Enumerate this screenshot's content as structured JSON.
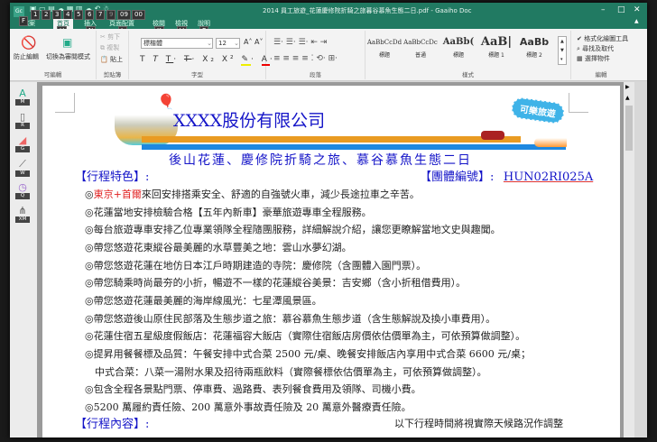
{
  "window": {
    "title": "2014 員工旅遊_花蓮慶修院折騎之旅暮谷慕魚生態二日.pdf - Gaaiho Doc",
    "app_icon": "Gc"
  },
  "quick_access_keys": [
    "1",
    "2",
    "3",
    "4",
    "5",
    "6",
    "7",
    "9",
    "09",
    "00"
  ],
  "tabs": [
    {
      "label": "檔案",
      "key": "F"
    },
    {
      "label": "首頁",
      "key": "H"
    },
    {
      "label": "插入",
      "key": "N"
    },
    {
      "label": "頁面配置",
      "key": "L"
    },
    {
      "label": "檢閱",
      "key": "K"
    },
    {
      "label": "檢視",
      "key": "V"
    },
    {
      "label": "說明",
      "key": "P"
    }
  ],
  "ribbon": {
    "protect": {
      "btn1": "防止編輯",
      "btn2": "切換為審閱模式",
      "label": "可編輯"
    },
    "clipboard": {
      "cut": "剪下",
      "copy": "複製",
      "paste": "貼上",
      "label": "剪貼簿"
    },
    "font": {
      "name": "標楷體",
      "size": "12",
      "label": "字型"
    },
    "paragraph": {
      "label": "段落"
    },
    "styles": {
      "items": [
        {
          "sample": "AaBbCcDd",
          "name": "標題"
        },
        {
          "sample": "AaBbCcDc",
          "name": "普通"
        },
        {
          "sample": "AaBb(",
          "name": "標題"
        },
        {
          "sample": "AaB|",
          "name": "標題 1"
        },
        {
          "sample": "AaBb",
          "name": "標題 2"
        }
      ],
      "label": "樣式"
    },
    "editing": {
      "format_painter": "格式化繪圖工具",
      "find_replace": "尋找及取代",
      "select_objects": "選擇物件",
      "label": "編輯"
    }
  },
  "left_tools": [
    {
      "key": "M",
      "icon": "text-icon"
    },
    {
      "key": "R",
      "icon": "document-search-icon"
    },
    {
      "key": "G",
      "icon": "shape-icon"
    },
    {
      "key": "W",
      "icon": "wand-icon"
    },
    {
      "key": "Q",
      "icon": "clock-icon"
    },
    {
      "key": "XM",
      "icon": "org-chart-icon"
    }
  ],
  "doc": {
    "company": "XXXX股份有限公司",
    "badge": "可樂旅遊",
    "subtitle": "後山花蓮、慶修院折騎之旅、慕谷慕魚生態二日",
    "features_heading": "【行程特色】:",
    "group_no_label": "【團體編號】:",
    "group_no": "HUN02RI025A",
    "line1_red": "東京+首爾",
    "line1_rest": "來回安排搭乘安全、舒適的自強號火車，減少長途拉車之辛苦。",
    "lines": [
      "◎花蓮當地安排檢驗合格【五年內新車】豪華旅遊專車全程服務。",
      "◎每台旅遊專車安排乙位專業領隊全程隨團服務，詳細解說介紹，讓您更瞭解當地文史與趣聞。",
      "◎帶您悠遊花東縱谷最美麗的水草豐美之地：雲山水夢幻湖。",
      "◎帶您悠遊花蓮在地仿日本江戶時期建造的寺院：慶修院（含團體入園門票）。",
      "◎帶您騎乘時尚最夯的小折，暢遊不一樣的花蓮縱谷美景：吉安鄉（含小折租借費用）。",
      "◎帶您悠遊花蓮最美麗的海岸線風光：七星潭風景區。",
      "◎帶您悠遊後山原住民部落及生態步道之旅：慕谷慕魚生態步道（含生態解說及換小車費用）。",
      "◎花蓮住宿五星級度假飯店：花蓮福容大飯店（實際住宿飯店房價依估價單為主，可依預算做調整）。",
      "◎提昇用餐餐標及品質：午餐安排中式合菜 2500 元/桌、晚餐安排飯店內享用中式合菜 6600 元/桌；",
      "　中式合菜：八菜一湯附水果及招待兩瓶飲料（實際餐標依估價單為主，可依預算做調整）。",
      "◎包含全程各景點門票、停車費、過路費、表列餐食費用及領隊、司機小費。",
      "◎5200 萬履約責任險、200 萬意外事故責任險及 20 萬意外醫療責任險。"
    ],
    "itinerary_heading": "【行程內容】:",
    "itinerary_note": "以下行程時間將視實際天候路況作調整"
  },
  "colors": {
    "titlebar": "#217a62",
    "doc_blue": "#1515c8",
    "accent_red": "#e02020"
  }
}
